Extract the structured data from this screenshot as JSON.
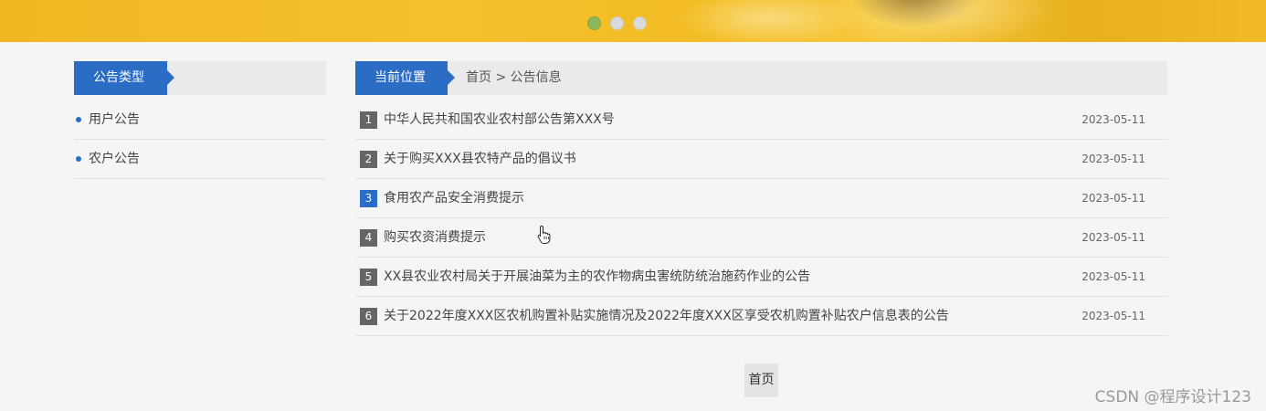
{
  "banner": {
    "slides": [
      "slide-1",
      "slide-2",
      "slide-3"
    ],
    "active_index": 0
  },
  "sidebar": {
    "title": "公告类型",
    "items": [
      {
        "label": "用户公告"
      },
      {
        "label": "农户公告"
      }
    ]
  },
  "main": {
    "location_tag": "当前位置",
    "breadcrumb": {
      "home": "首页",
      "separator": ">",
      "current": "公告信息"
    },
    "rows": [
      {
        "num": "1",
        "title": "中华人民共和国农业农村部公告第XXX号",
        "date": "2023-05-11"
      },
      {
        "num": "2",
        "title": "关于购买XXX县农特产品的倡议书",
        "date": "2023-05-11"
      },
      {
        "num": "3",
        "title": "食用农产品安全消费提示",
        "date": "2023-05-11",
        "highlight": true
      },
      {
        "num": "4",
        "title": "购买农资消费提示",
        "date": "2023-05-11"
      },
      {
        "num": "5",
        "title": "XX县农业农村局关于开展油菜为主的农作物病虫害统防统治施药作业的公告",
        "date": "2023-05-11"
      },
      {
        "num": "6",
        "title": "关于2022年度XXX区农机购置补贴实施情况及2022年度XXX区享受农机购置补贴农户信息表的公告",
        "date": "2023-05-11"
      }
    ]
  },
  "pagination": {
    "first_label": "首页"
  },
  "watermark": "CSDN @程序设计123",
  "colors": {
    "accent": "#2b6cc4",
    "banner": "#f2b821",
    "active_dot": "#8cb85b"
  }
}
